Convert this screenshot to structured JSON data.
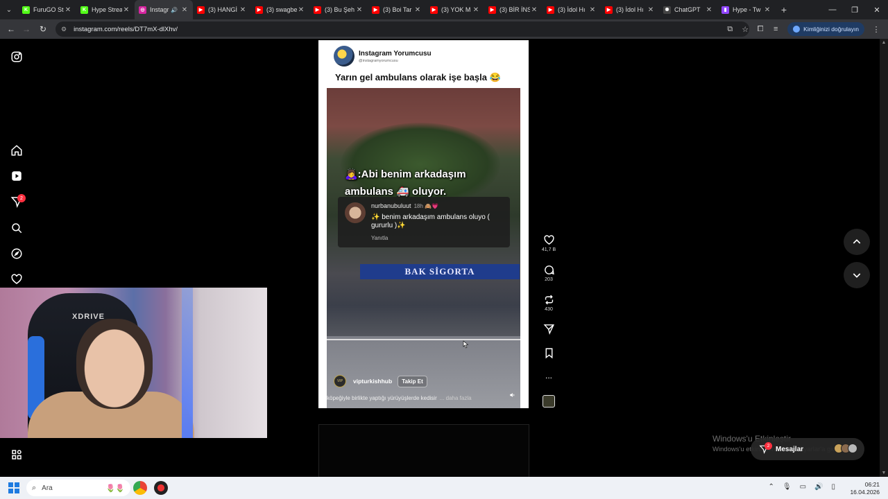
{
  "browser": {
    "tabs": [
      {
        "title": "FuruGO St",
        "favicon_color": "#53fc18",
        "favicon_char": "K"
      },
      {
        "title": "Hype Strea",
        "favicon_color": "#53fc18",
        "favicon_char": "K"
      },
      {
        "title": "Instagr",
        "favicon_color": "#d6249f",
        "favicon_char": "◎",
        "active": true
      },
      {
        "title": "(3) HANGİ",
        "favicon_color": "#ff0000",
        "favicon_char": "▶"
      },
      {
        "title": "(3) swagbe",
        "favicon_color": "#ff0000",
        "favicon_char": "▶"
      },
      {
        "title": "(3) Bu Şeh",
        "favicon_color": "#ff0000",
        "favicon_char": "▶"
      },
      {
        "title": "(3) Boi Tar",
        "favicon_color": "#ff0000",
        "favicon_char": "▶"
      },
      {
        "title": "(3) YOK M",
        "favicon_color": "#ff0000",
        "favicon_char": "▶"
      },
      {
        "title": "(3) BİR İNS",
        "favicon_color": "#ff0000",
        "favicon_char": "▶"
      },
      {
        "title": "(3) İdol Hı",
        "favicon_color": "#ff0000",
        "favicon_char": "▶"
      },
      {
        "title": "(3) İdol Hı",
        "favicon_color": "#ff0000",
        "favicon_char": "▶"
      },
      {
        "title": "ChatGPT",
        "favicon_color": "#444444",
        "favicon_char": "✺"
      },
      {
        "title": "Hype - Tw",
        "favicon_color": "#9146ff",
        "favicon_char": "▮"
      }
    ],
    "url": "instagram.com/reels/DT7mX-dlXhv/",
    "verify_label": "Kimliğinizi doğrulayın"
  },
  "reel": {
    "account_name": "Instagram Yorumcusu",
    "account_handle": "@instagramyorumcusu",
    "caption": "Yarın gel ambulans olarak işe başla 😂",
    "overlay_title": "🙇‍♀️:Abi benim arkadaşım ambulans 🚑 oluyor.",
    "comment": {
      "user": "nurbanubuluut",
      "time": "18h 🙈💗",
      "text": "✨ benim arkadaşım ambulans oluyo ( gururlu )✨",
      "reply": "Yanıtla"
    },
    "sign_text": "BAK SİGORTA",
    "poster": "vipturkishhub",
    "poster_badge": "VIP",
    "follow_label": "Takip Et",
    "description": "köpeğiyle birlikte yaptığı yürüyüşlerde kedisir",
    "more_label": "... daha fazla"
  },
  "actions": {
    "likes": "41,7 B",
    "comments": "203",
    "reposts": "430",
    "more": "..."
  },
  "side_nav": {
    "notification_count": "2"
  },
  "webcam": {
    "chair_brand": "XDRIVE"
  },
  "windows": {
    "activate_title": "Windows'u Etkinleştir",
    "activate_sub": "Windows'u etkinleştirmek için Ayarlar'a gidin.",
    "messages_label": "Mesajlar",
    "messages_badge": "2",
    "taskbar_search": "Ara",
    "time": "06:21",
    "date": "16.04.2026"
  }
}
